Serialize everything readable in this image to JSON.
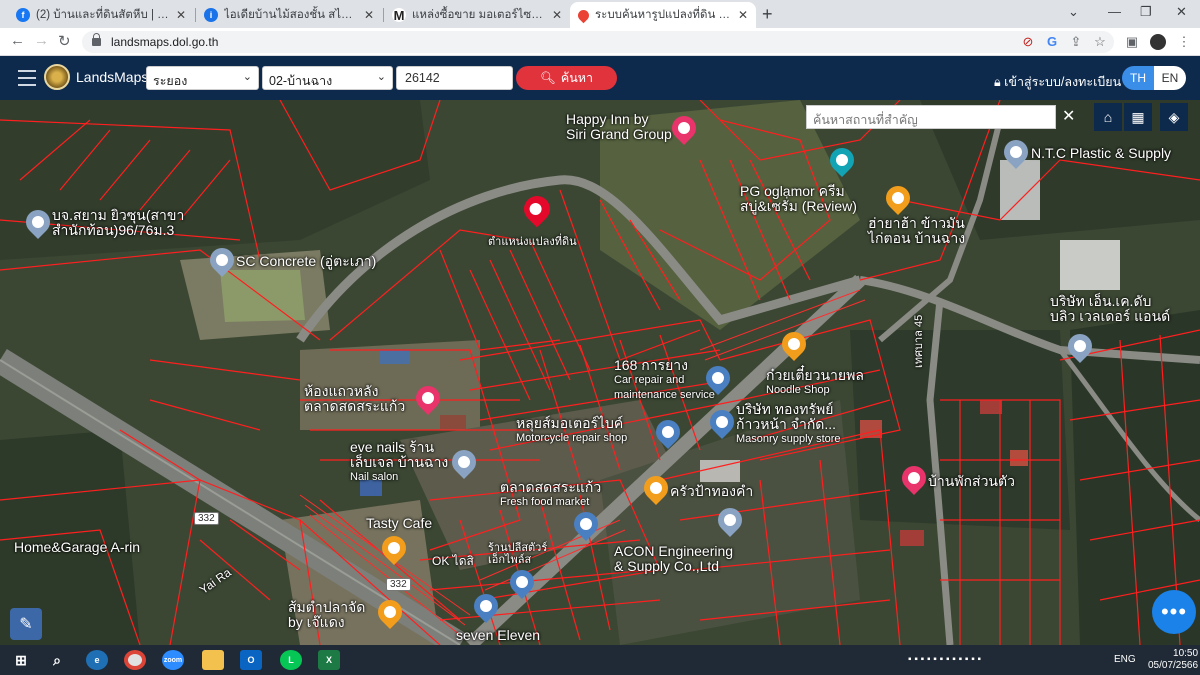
{
  "browser": {
    "tabs": [
      {
        "title": "(2) บ้านและที่ดินสัตหีบ | Facebook",
        "favicon": "facebook-icon",
        "color": "#1877f2",
        "glyph": "f"
      },
      {
        "title": "ไอเดียบ้านไม้สองชั้น สไตล์สวนเกษตร ฆ",
        "favicon": "idea-site-icon",
        "color": "#1a73e8",
        "glyph": "i"
      },
      {
        "title": "แหล่งซื้อขาย มอเตอร์ไซค์ บิ๊กไบค์ มือสอง",
        "favicon": "m-site-icon",
        "color": "#222222",
        "glyph": "M"
      },
      {
        "title": "ระบบค้นหารูปแปลงที่ดิน (LandsMaps",
        "favicon": "map-pin-icon",
        "color": "#ea4335",
        "glyph": "●",
        "active": true
      }
    ],
    "url": "landsmaps.dol.go.th"
  },
  "header": {
    "brand": "LandsMaps",
    "province": "ระยอง",
    "district": "02-บ้านฉาง",
    "parcel_number": "26142",
    "search_label": "ค้นหา",
    "login_label": "เข้าสู่ระบบ/ลงทะเบียน",
    "lang_th": "TH",
    "lang_en": "EN"
  },
  "map": {
    "place_search_placeholder": "ค้นหาสถานที่สำคัญ",
    "parcel_marker_label": "ตำแหน่งแปลงที่ดิน",
    "labels": {
      "happy_inn_1": "Happy Inn by",
      "happy_inn_2": "Siri Grand Group",
      "ntc": "N.T.C Plastic & Supply",
      "pg_1": "PG oglamor ครีม",
      "pg_2": "สบู่&เซรั่ม (Review)",
      "food_1": "ฮ่ายาฮ้า ข้าวมัน",
      "food_2": "ไก่ตอน บ้านฉาง",
      "siam_1": "บจ.สยาม ยิวซุน(สาขา",
      "siam_2": "สำนักท้อน)96/76ม.3",
      "sc_concrete": "SC Concrete (อู่ตะเภา)",
      "welder_1": "บริษัท เอ็น.เค.ดับ",
      "welder_2": "บลิว เวลเดอร์ แอนด์",
      "repair_1": "168 การยาง",
      "repair_2": "Car repair and",
      "repair_3": "maintenance service",
      "noodle_1": "ก๋วยเตี๋ยวนายพล",
      "noodle_2": "Noodle Shop",
      "mason_1": "บริษัท ทองทรัพย์",
      "mason_2": "ก้าวหน้า จำกัด...",
      "mason_3": "Masonry supply store",
      "market_1": "ห้องแถวหลัง",
      "market_2": "ตลาดสดสระแก้ว",
      "moto_1": "หลุยส์มอเตอร์ไบค์",
      "moto_2": "Motorcycle repair shop",
      "tessaban": "เทศบาล 45",
      "nails_1": "eve nails ร้าน",
      "nails_2": "เล็บเจล บ้านฉาง",
      "nails_3": "Nail salon",
      "fresh_1": "ตลาดสดสระแก้ว",
      "fresh_2": "Fresh food market",
      "krua": "ครัวป้าทองคำ",
      "homestay": "บ้านพักส่วนตัว",
      "tasty": "Tasty Cafe",
      "home_garage": "Home&Garage A-rin",
      "ok_1": "OK ไดสิ",
      "ok_2": "ร้านปลีสตัวร์",
      "ok_3": "เอ็กไพล์ส",
      "acon_1": "ACON Engineering",
      "acon_2": "& Supply Co.,Ltd",
      "yai_ra": "Yai Ra",
      "somtam_1": "ส้มตำปลาจัด",
      "somtam_2": "by เจ๊แดง",
      "seven": "seven Eleven",
      "road_332a": "332",
      "road_332b": "332"
    }
  },
  "taskbar": {
    "time": "10:50",
    "date": "05/07/2566",
    "lang": "ENG"
  }
}
